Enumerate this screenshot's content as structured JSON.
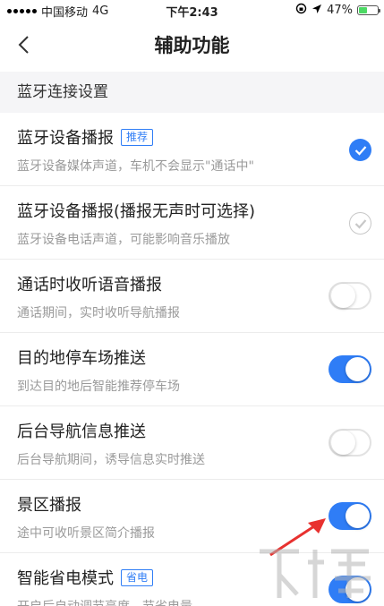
{
  "status_bar": {
    "carrier": "中国移动",
    "network": "4G",
    "time": "下午2:43",
    "battery_percent": "47%",
    "battery_level": 0.47
  },
  "nav": {
    "title": "辅助功能"
  },
  "section": {
    "title": "蓝牙连接设置"
  },
  "items": [
    {
      "title": "蓝牙设备播报",
      "badge": "推荐",
      "desc": "蓝牙设备媒体声道，车机不会显示\"通话中\"",
      "control": "check",
      "state": "on"
    },
    {
      "title": "蓝牙设备播报(播报无声时可选择)",
      "badge": "",
      "desc": "蓝牙设备电话声道，可能影响音乐播放",
      "control": "check",
      "state": "off"
    },
    {
      "title": "通话时收听语音播报",
      "badge": "",
      "desc": "通话期间，实时收听导航播报",
      "control": "toggle",
      "state": "off"
    },
    {
      "title": "目的地停车场推送",
      "badge": "",
      "desc": "到达目的地后智能推荐停车场",
      "control": "toggle",
      "state": "on"
    },
    {
      "title": "后台导航信息推送",
      "badge": "",
      "desc": "后台导航期间，诱导信息实时推送",
      "control": "toggle",
      "state": "off"
    },
    {
      "title": "景区播报",
      "badge": "",
      "desc": "途中可收听景区简介播报",
      "control": "toggle",
      "state": "on"
    },
    {
      "title": "智能省电模式",
      "badge": "省电",
      "desc": "开启后自动调节亮度，节省电量",
      "control": "toggle",
      "state": "on"
    }
  ],
  "colors": {
    "accent": "#2f7df6",
    "annotation_arrow": "#e8312f",
    "section_bg": "#f5f5f7",
    "desc_text": "#9a9a9a"
  },
  "icons": {
    "back": "chevron-left-icon",
    "check": "checkmark-icon",
    "location": "location-arrow-icon",
    "lock": "orientation-lock-icon"
  }
}
